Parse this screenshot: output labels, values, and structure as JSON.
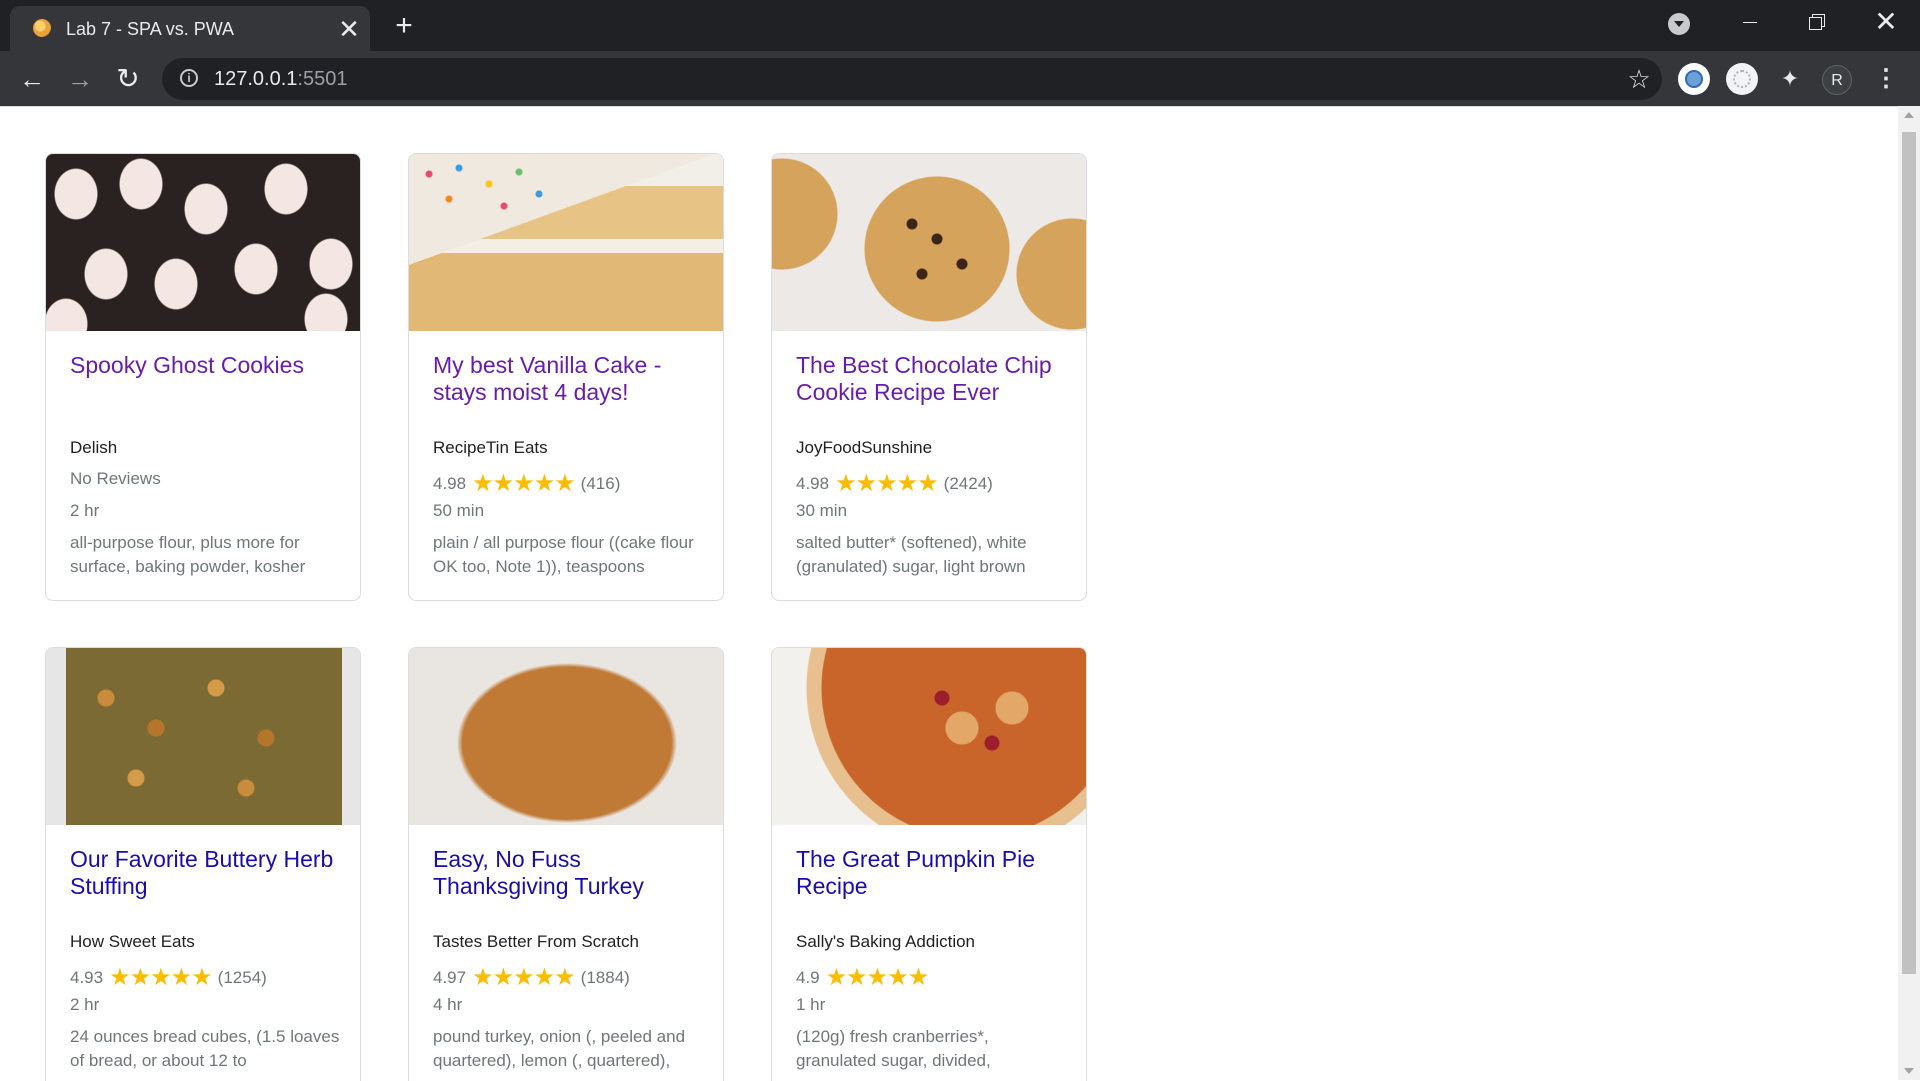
{
  "browser": {
    "tab_title": "Lab 7 - SPA vs. PWA",
    "tab_close_label": "✕",
    "new_tab_label": "+",
    "url_host": "127.0.0.1",
    "url_port": ":5501",
    "profile_initial": "R",
    "icons": [
      "tab-favicon",
      "close-icon",
      "plus-icon",
      "tab-search-icon",
      "minimize-icon",
      "restore-icon",
      "close-window-icon",
      "back-icon",
      "forward-icon",
      "reload-icon",
      "info-icon",
      "bookmark-star-icon",
      "extension-icon",
      "puzzle-icon",
      "avatar",
      "menu-icon"
    ]
  },
  "recipes": [
    {
      "title": "Spooky Ghost Cookies",
      "source": "Delish",
      "rating": "",
      "stars": "",
      "review_count": "",
      "no_reviews": "No Reviews",
      "time": "2 hr",
      "ingredients": "all-purpose flour, plus more for surface, baking powder, kosher",
      "title_color": "#681da8"
    },
    {
      "title": "My best Vanilla Cake - stays moist 4 days!",
      "source": "RecipeTin Eats",
      "rating": "4.98",
      "stars": "★★★★★",
      "review_count": "(416)",
      "no_reviews": "",
      "time": "50 min",
      "ingredients": "plain / all purpose flour ((cake flour OK too, Note 1)), teaspoons",
      "title_color": "#681da8"
    },
    {
      "title": "The Best Chocolate Chip Cookie Recipe Ever",
      "source": "JoyFoodSunshine",
      "rating": "4.98",
      "stars": "★★★★★",
      "review_count": "(2424)",
      "no_reviews": "",
      "time": "30 min",
      "ingredients": "salted butter* (softened), white (granulated) sugar, light brown",
      "title_color": "#681da8"
    },
    {
      "title": "Our Favorite Buttery Herb Stuffing",
      "source": "How Sweet Eats",
      "rating": "4.93",
      "stars": "★★★★★",
      "review_count": "(1254)",
      "no_reviews": "",
      "time": "2 hr",
      "ingredients": "24 ounces bread cubes, (1.5 loaves of bread, or about 12 to",
      "title_color": "#1a0dab"
    },
    {
      "title": "Easy, No Fuss Thanksgiving Turkey",
      "source": "Tastes Better From Scratch",
      "rating": "4.97",
      "stars": "★★★★★",
      "review_count": "(1884)",
      "no_reviews": "",
      "time": "4 hr",
      "ingredients": "pound turkey, onion (, peeled and quartered), lemon (, quartered),",
      "title_color": "#1a0dab"
    },
    {
      "title": "The Great Pumpkin Pie Recipe",
      "source": "Sally's Baking Addiction",
      "rating": "4.9",
      "stars": "★★★★★",
      "review_count": "",
      "no_reviews": "",
      "time": "1 hr",
      "ingredients": "(120g) fresh cranberries*, granulated sugar, divided,",
      "title_color": "#1a0dab"
    }
  ],
  "colors": {
    "visited_link": "#681da8",
    "link": "#1a0dab",
    "star": "#fbbc04",
    "muted_text": "#70757a"
  }
}
